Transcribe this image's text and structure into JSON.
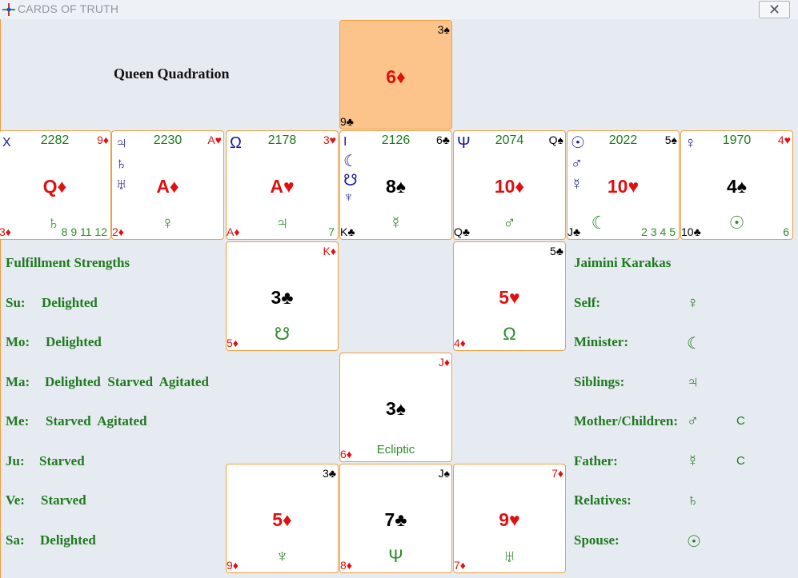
{
  "window": {
    "title": "CARDS OF TRUTH",
    "close_label": "✕"
  },
  "spread_title": "Queen Quadration",
  "center_card": {
    "card": "6♦",
    "top_right": "3♠",
    "bottom_left": "9♣"
  },
  "top_row": [
    {
      "left_syms": [
        "X"
      ],
      "number": "2282",
      "card": "Q♦",
      "card_color": "red",
      "top_right": "9♦",
      "bottom_left": "3♦",
      "planet": "♄",
      "bottom_right": "8 9 11 12"
    },
    {
      "left_syms": [
        "♃",
        "♄",
        "♅"
      ],
      "number": "2230",
      "card": "A♦",
      "card_color": "red",
      "top_right": "A♥",
      "bottom_left": "2♦",
      "planet": "♀",
      "bottom_right": ""
    },
    {
      "left_syms": [
        "Ω"
      ],
      "number": "2178",
      "card": "A♥",
      "card_color": "red",
      "top_right": "3♥",
      "bottom_left": "A♦",
      "planet": "♃",
      "bottom_right": "7"
    },
    {
      "left_syms": [
        "I",
        "☾",
        "☋",
        "♆"
      ],
      "number": "2126",
      "card": "8♠",
      "card_color": "black",
      "top_right": "6♣",
      "bottom_left": "K♣",
      "planet": "☿",
      "bottom_right": ""
    },
    {
      "left_syms": [
        "Ψ"
      ],
      "number": "2074",
      "card": "10♦",
      "card_color": "red",
      "top_right": "Q♠",
      "bottom_left": "Q♣",
      "planet": "♂",
      "bottom_right": ""
    },
    {
      "left_syms": [
        "☉",
        "♂",
        "☿"
      ],
      "number": "2022",
      "card": "10♥",
      "card_color": "red",
      "top_right": "5♠",
      "bottom_left": "J♣",
      "planet": "☾",
      "bottom_right": "2 3 4 5"
    },
    {
      "left_syms": [
        "♀"
      ],
      "number": "1970",
      "card": "4♠",
      "card_color": "black",
      "top_right": "4♥",
      "bottom_left": "10♣",
      "planet": "☉",
      "bottom_right": "6"
    }
  ],
  "middle_cards": [
    {
      "card": "3♣",
      "card_color": "black",
      "top_right": "K♦",
      "bottom_left": "5♦",
      "planet": "☋"
    },
    {
      "card": "5♥",
      "card_color": "red",
      "top_right": "5♣",
      "bottom_left": "4♦",
      "planet": "Ω"
    }
  ],
  "ecliptic_card": {
    "card": "3♠",
    "top_right": "J♦",
    "bottom_left": "6♦",
    "caption": "Ecliptic"
  },
  "bottom_row": [
    {
      "card": "5♦",
      "card_color": "red",
      "top_right": "3♣",
      "bottom_left": "9♦",
      "planet": "♆"
    },
    {
      "card": "7♣",
      "card_color": "black",
      "top_right": "J♠",
      "bottom_left": "8♦",
      "planet": "Ψ"
    },
    {
      "card": "9♥",
      "card_color": "red",
      "top_right": "7♦",
      "bottom_left": "7♦",
      "planet": "♅"
    }
  ],
  "fulfillment": {
    "title": "Fulfillment Strengths",
    "rows": [
      {
        "label": "Su:",
        "value": "Delighted"
      },
      {
        "label": "Mo:",
        "value": "Delighted"
      },
      {
        "label": "Ma:",
        "value": "Delighted  Starved  Agitated"
      },
      {
        "label": "Me:",
        "value": "Starved  Agitated"
      },
      {
        "label": "Ju:",
        "value": "Starved"
      },
      {
        "label": "Ve:",
        "value": "Starved"
      },
      {
        "label": "Sa:",
        "value": "Delighted"
      }
    ]
  },
  "karakas": {
    "title": "Jaimini Karakas",
    "rows": [
      {
        "label": "Self:",
        "glyph": "♀",
        "flag": ""
      },
      {
        "label": "Minister:",
        "glyph": "☾",
        "flag": ""
      },
      {
        "label": "Siblings:",
        "glyph": "♃",
        "flag": ""
      },
      {
        "label": "Mother/Children:",
        "glyph": "♂",
        "flag": "C"
      },
      {
        "label": "Father:",
        "glyph": "☿",
        "flag": "C"
      },
      {
        "label": "Relatives:",
        "glyph": "♄",
        "flag": ""
      },
      {
        "label": "Spouse:",
        "glyph": "☉",
        "flag": ""
      }
    ]
  },
  "colors": {
    "accent_border": "#f0a040",
    "center_fill": "#fcc48a",
    "red_suit": "#e01010",
    "green_text": "#1f7a1f",
    "blue_glyph": "#1a1aa0",
    "background": "#e6eaf1"
  }
}
